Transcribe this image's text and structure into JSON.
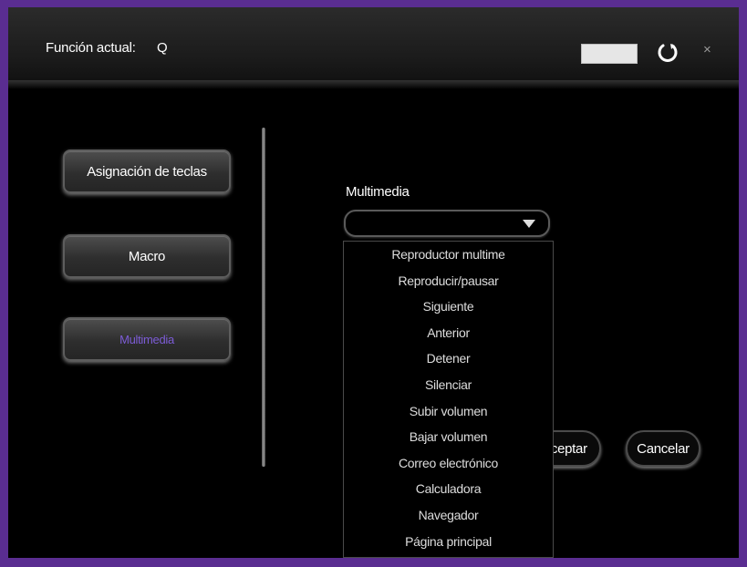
{
  "header": {
    "title": "Función actual:",
    "current_key": "Q",
    "close_symbol": "×",
    "swatch_color": "#e6e6e6"
  },
  "sidebar": {
    "items": [
      {
        "label": "Asignación de teclas",
        "active": false
      },
      {
        "label": "Macro",
        "active": false
      },
      {
        "label": "Multimedia",
        "active": true
      }
    ]
  },
  "main": {
    "section_label": "Multimedia",
    "select_value": "",
    "options": [
      "Reproductor multime",
      "Reproducir/pausar",
      "Siguiente",
      "Anterior",
      "Detener",
      "Silenciar",
      "Subir volumen",
      "Bajar volumen",
      "Correo electrónico",
      "Calculadora",
      "Navegador",
      "Página principal"
    ],
    "accept_label": "Aceptar",
    "cancel_label": "Cancelar"
  },
  "colors": {
    "frame": "#5a2d91",
    "active_text": "#7c5cd6"
  }
}
